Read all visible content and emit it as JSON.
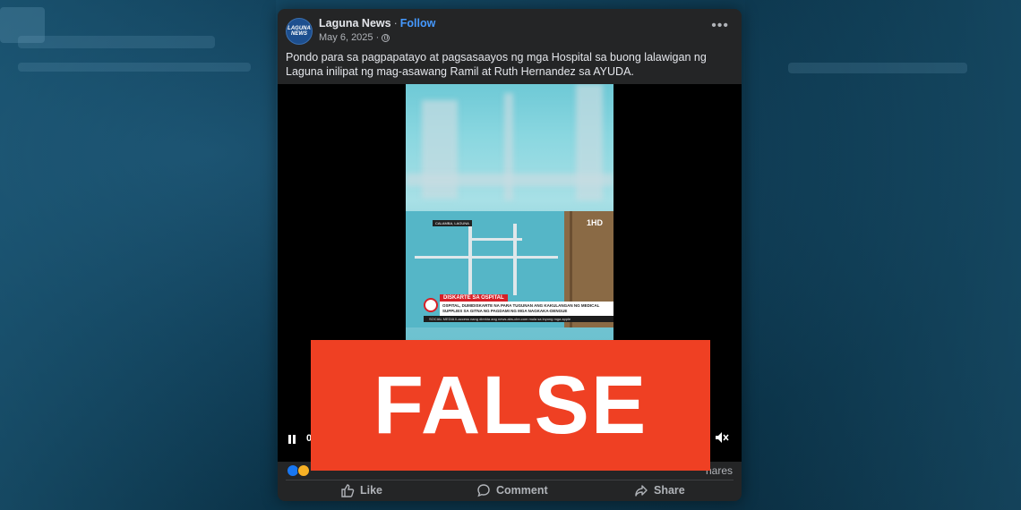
{
  "post": {
    "page_name": "Laguna News",
    "follow_label": "Follow",
    "avatar_text": "LAGUNA NEWS",
    "date": "May 6, 2025 ·",
    "more_label": "•••",
    "caption": "Pondo para sa pagpapatayo at pagsasaayos ng mga Hospital sa buong lalawigan ng Laguna inilipat ng mag-asawang Ramil at Ruth Hernandez sa AYUDA."
  },
  "video": {
    "hd_badge": "1HD",
    "location_tag": "CALAMBA, LAGUNA",
    "lower_third_title": "DISKARTE SA OSPITAL",
    "lower_third_body": "OSPITAL, DUMIDISKARTE NA PARA TUGUNAN ANG KAKULANGAN NG MEDICAL SUPPLIES SA GITNA NG PAGDAMI NG MGA NAGKAKA-DENGUE",
    "ticker": "SOCIAL MEDIA  Ii-access nang direkta ang news.abs-cbn.com mula sa inyong mga apple",
    "time": "0"
  },
  "stats": {
    "shares_label": "hares"
  },
  "actions": {
    "like_label": "Like",
    "comment_label": "Comment",
    "share_label": "Share"
  },
  "stamp": {
    "text": "FALSE",
    "color": "#ef4023"
  }
}
